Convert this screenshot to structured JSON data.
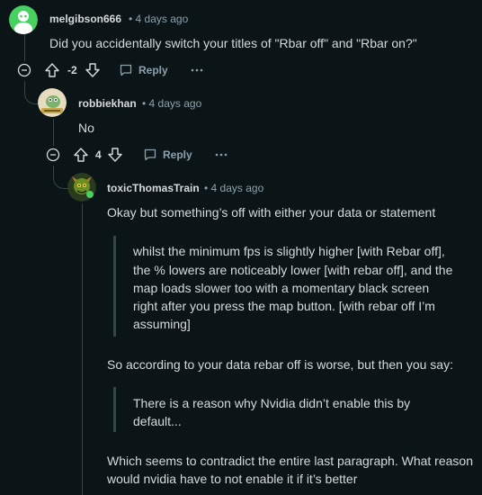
{
  "comments": [
    {
      "username": "melgibson666",
      "time": "• 4 days ago",
      "body": "Did you accidentally switch your titles of \"Rbar off\" and \"Rbar on?\"",
      "score": "-2",
      "reply_label": "Reply"
    },
    {
      "username": "robbiekhan",
      "time": "• 4 days ago",
      "body": "No",
      "score": "4",
      "reply_label": "Reply"
    },
    {
      "username": "toxicThomasTrain",
      "time": "• 4 days ago",
      "p1": "Okay but something’s off with either your data or statement",
      "quote1": [
        "whilst the minimum fps is slightly higher [with Rebar off],",
        "the % lowers are noticeably lower [with rebar off], and the",
        "map loads slower too with a momentary black screen",
        "right after you press the map button. [with rebar off I’m",
        "assuming]"
      ],
      "p2": "So according to your data rebar off is worse, but then you say:",
      "quote2": [
        "There is a reason why Nvidia didn’t enable this by",
        "default..."
      ],
      "p3": [
        "Which seems to contradict the entire last paragraph. What reason",
        "would nvidia have to not enable it if it’s better"
      ]
    }
  ],
  "colors": {
    "background": "#0b1416",
    "text": "#d7dadc",
    "meta": "#8ba2ad",
    "thread_line": "#33464c"
  },
  "icons": [
    "collapse-icon",
    "upvote-icon",
    "downvote-icon",
    "reply-icon",
    "more-options-icon"
  ]
}
